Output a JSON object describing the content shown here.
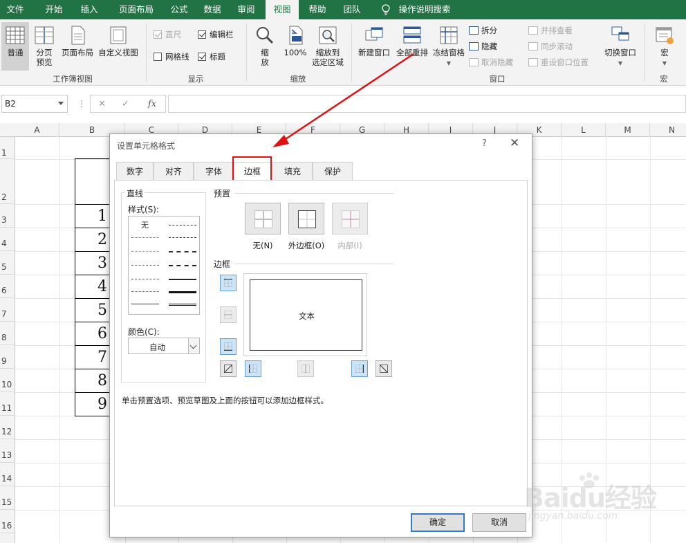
{
  "ribbon_tabs": [
    "文件",
    "开始",
    "插入",
    "页面布局",
    "公式",
    "数据",
    "审阅",
    "视图",
    "帮助",
    "团队",
    "操作说明搜索"
  ],
  "active_tab": "视图",
  "groups": {
    "workbook_views": {
      "label": "工作簿视图",
      "normal": "普通",
      "page_break_1": "分页",
      "page_break_2": "预览",
      "page_layout": "页面布局",
      "custom_views": "自定义视图"
    },
    "show": {
      "label": "显示",
      "ruler": "直尺",
      "formula_bar": "编辑栏",
      "gridlines": "网格线",
      "headings": "标题"
    },
    "zoom": {
      "label": "缩放",
      "zoom_1": "缩",
      "zoom_2": "放",
      "zoom_100": "100%",
      "zoom_sel_1": "缩放到",
      "zoom_sel_2": "选定区域"
    },
    "window": {
      "label": "窗口",
      "new_window": "新建窗口",
      "arrange_all": "全部重排",
      "freeze_panes": "冻结窗格",
      "split": "拆分",
      "hide": "隐藏",
      "unhide": "取消隐藏",
      "side_by_side": "并排查看",
      "sync_scroll": "同步滚动",
      "reset_pos": "重设窗口位置",
      "switch_windows": "切换窗口"
    },
    "macros": {
      "label": "宏",
      "macros": "宏"
    }
  },
  "name_box": "B2",
  "column_headers": [
    "A",
    "B",
    "C",
    "D",
    "E",
    "F",
    "G",
    "H",
    "I",
    "J",
    "K",
    "L",
    "M",
    "N"
  ],
  "row_headers": [
    "1",
    "2",
    "3",
    "4",
    "5",
    "6",
    "7",
    "8",
    "9",
    "10",
    "11",
    "12",
    "13",
    "14",
    "15",
    "16"
  ],
  "cell_values": [
    "1",
    "2",
    "3",
    "4",
    "5",
    "6",
    "7",
    "8",
    "9"
  ],
  "dialog": {
    "title": "设置单元格格式",
    "help": "?",
    "close": "✕",
    "tabs": [
      "数字",
      "对齐",
      "字体",
      "边框",
      "填充",
      "保护"
    ],
    "active_tab": "边框",
    "line_section": "直线",
    "style_label": "样式(S):",
    "style_none": "无",
    "color_label": "颜色(C):",
    "color_value": "自动",
    "presets_label": "预置",
    "preset_none": "无(N)",
    "preset_outline": "外边框(O)",
    "preset_inside": "内部(I)",
    "border_label": "边框",
    "preview_text": "文本",
    "hint": "单击预置选项、预览草图及上面的按钮可以添加边框样式。",
    "ok": "确定",
    "cancel": "取消"
  },
  "watermark": {
    "logo": "Baidu经验",
    "url": "jingyan.baidu.com"
  }
}
